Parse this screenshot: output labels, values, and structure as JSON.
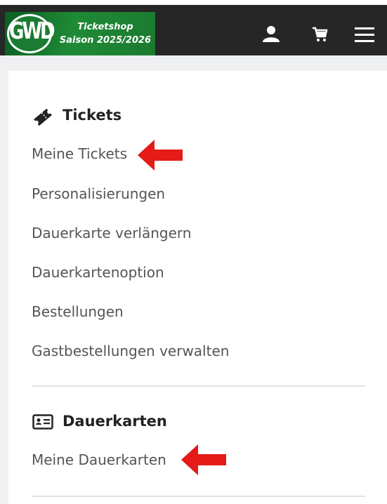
{
  "header": {
    "logo_letters": "GWD",
    "shop_title": "Ticketshop",
    "season": "Saison 2025/2026",
    "icons": [
      "user-icon",
      "cart-icon",
      "menu-icon"
    ]
  },
  "sections": {
    "tickets": {
      "icon": "ticket-icon",
      "title": "Tickets",
      "items": [
        "Meine Tickets",
        "Personalisierungen",
        "Dauerkarte verlängern",
        "Dauerkartenoption",
        "Bestellungen",
        "Gastbestellungen verwalten"
      ]
    },
    "dauerkarten": {
      "icon": "id-card-icon",
      "title": "Dauerkarten",
      "items": [
        "Meine Dauerkarten"
      ]
    }
  },
  "annotations": {
    "arrow_color": "#e41b17",
    "accent_green": "#1f8a36"
  }
}
